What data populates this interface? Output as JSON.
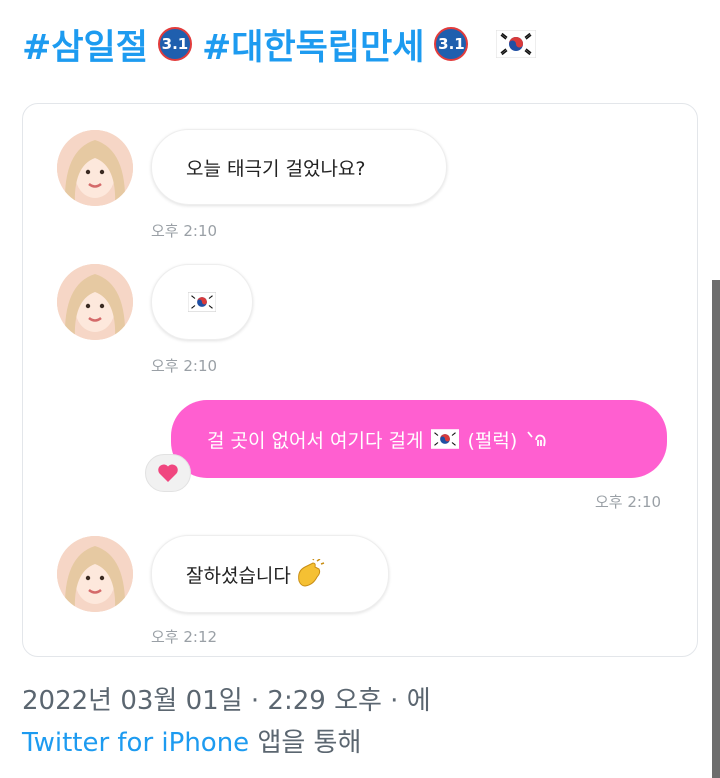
{
  "hashtags": [
    {
      "text": "#삼일절",
      "badge": "3.1"
    },
    {
      "text": "#대한독립만세",
      "badge": "3.1"
    }
  ],
  "flag_icon": "south-korea-flag-icon",
  "messages": [
    {
      "text": "오늘 태극기 걸었나요?",
      "time": "오후 2:10"
    },
    {
      "text": "",
      "time": "오후 2:10"
    },
    {
      "text_before": "걸 곳이 없어서 여기다 걸게",
      "text_after": "(펄럭)",
      "time": "오후 2:10"
    },
    {
      "text": "잘하셨습니다",
      "time": "오후 2:12"
    }
  ],
  "tweet_meta": {
    "date": "2022년 03월 01일 · 2:29 오후 · 에",
    "source_link": "Twitter for iPhone",
    "source_suffix": "앱을 통해"
  },
  "colors": {
    "accent": "#1d9bf0",
    "my_bubble": "#ff5fd0",
    "heart": "#f0467f"
  }
}
